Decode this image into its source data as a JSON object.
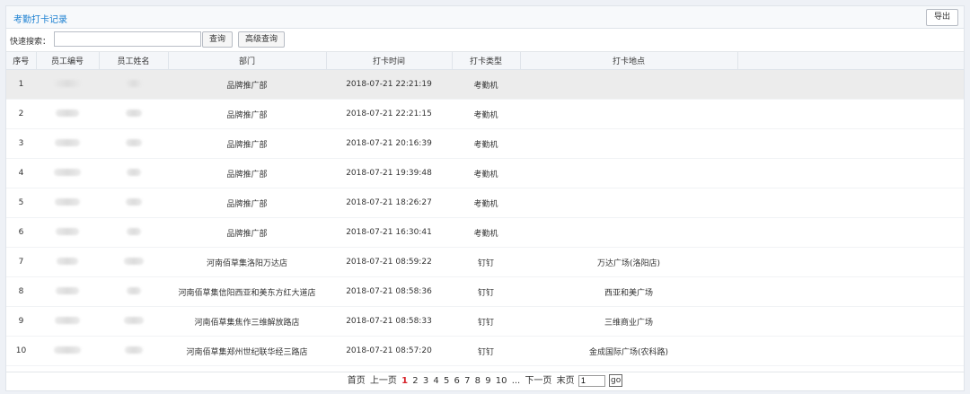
{
  "header": {
    "title": "考勤打卡记录",
    "export_label": "导出"
  },
  "search": {
    "label": "快速搜索：",
    "value": "",
    "search_btn": "查询",
    "advanced_btn": "高级查询"
  },
  "table": {
    "columns": [
      "序号",
      "员工编号",
      "员工姓名",
      "部门",
      "打卡时间",
      "打卡类型",
      "打卡地点"
    ],
    "rows": [
      {
        "no": "1",
        "dept": "品牌推广部",
        "time": "2018-07-21 22:21:19",
        "type": "考勤机",
        "place": ""
      },
      {
        "no": "2",
        "dept": "品牌推广部",
        "time": "2018-07-21 22:21:15",
        "type": "考勤机",
        "place": ""
      },
      {
        "no": "3",
        "dept": "品牌推广部",
        "time": "2018-07-21 20:16:39",
        "type": "考勤机",
        "place": ""
      },
      {
        "no": "4",
        "dept": "品牌推广部",
        "time": "2018-07-21 19:39:48",
        "type": "考勤机",
        "place": ""
      },
      {
        "no": "5",
        "dept": "品牌推广部",
        "time": "2018-07-21 18:26:27",
        "type": "考勤机",
        "place": ""
      },
      {
        "no": "6",
        "dept": "品牌推广部",
        "time": "2018-07-21 16:30:41",
        "type": "考勤机",
        "place": ""
      },
      {
        "no": "7",
        "dept": "河南佰草集洛阳万达店",
        "time": "2018-07-21 08:59:22",
        "type": "钉钉",
        "place": "万达广场(洛阳店)"
      },
      {
        "no": "8",
        "dept": "河南佰草集信阳西亚和美东方红大道店",
        "time": "2018-07-21 08:58:36",
        "type": "钉钉",
        "place": "西亚和美广场"
      },
      {
        "no": "9",
        "dept": "河南佰草集焦作三维解放路店",
        "time": "2018-07-21 08:58:33",
        "type": "钉钉",
        "place": "三维商业广场"
      },
      {
        "no": "10",
        "dept": "河南佰草集郑州世纪联华经三路店",
        "time": "2018-07-21 08:57:20",
        "type": "钉钉",
        "place": "金成国际广场(农科路)"
      }
    ]
  },
  "pager": {
    "first": "首页",
    "prev": "上一页",
    "current": "1",
    "pages": [
      "2",
      "3",
      "4",
      "5",
      "6",
      "7",
      "8",
      "9",
      "10"
    ],
    "ellipsis": "...",
    "next": "下一页",
    "last": "末页",
    "page_input": "1",
    "go": "go"
  }
}
